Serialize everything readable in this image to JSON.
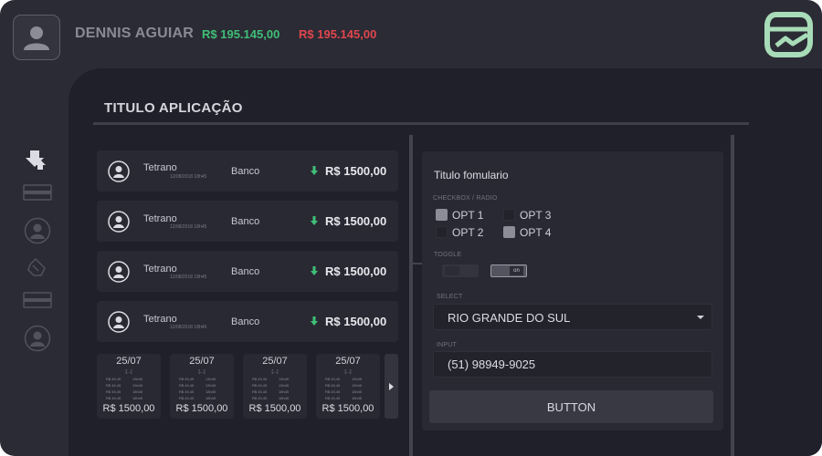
{
  "header": {
    "user_name": "DENNIS AGUIAR",
    "balance_green": "R$ 195.145,00",
    "balance_red": "R$ 195.145,00",
    "icons": [
      "avatar-icon",
      "wallet-logo-icon"
    ],
    "colors": {
      "positive": "#3fbf77",
      "negative": "#e0464e",
      "logo": "#a8dcb8"
    }
  },
  "page": {
    "title": "TITULO APLICAÇÃO"
  },
  "sidebar": {
    "icons": [
      "download-upload-icon",
      "card-icon",
      "user-icon",
      "hand-icon",
      "card-icon",
      "user-icon"
    ]
  },
  "list": {
    "items": [
      {
        "name": "Tetrano",
        "date": "12/08/2018 18h45",
        "bank": "Banco",
        "amount": "R$ 1500,00"
      },
      {
        "name": "Tetrano",
        "date": "12/08/2018 18h45",
        "bank": "Banco",
        "amount": "R$ 1500,00"
      },
      {
        "name": "Tetrano",
        "date": "12/08/2018 18h45",
        "bank": "Banco",
        "amount": "R$ 1500,00"
      },
      {
        "name": "Tetrano",
        "date": "12/08/2018 18h45",
        "bank": "Banco",
        "amount": "R$ 1500,00"
      }
    ]
  },
  "cards": {
    "items": [
      {
        "date": "25/07",
        "ellipsis": "[...]",
        "rows": [
          [
            "R$ 45,45",
            "13h45"
          ],
          [
            "R$ 45,45",
            "13h45"
          ],
          [
            "R$ 45,45",
            "18h45"
          ],
          [
            "R$ 45,45",
            "18h45"
          ]
        ],
        "total": "R$ 1500,00"
      },
      {
        "date": "25/07",
        "ellipsis": "[...]",
        "rows": [
          [
            "R$ 45,45",
            "13h45"
          ],
          [
            "R$ 45,45",
            "13h45"
          ],
          [
            "R$ 45,45",
            "18h45"
          ],
          [
            "R$ 45,45",
            "18h45"
          ]
        ],
        "total": "R$ 1500,00"
      },
      {
        "date": "25/07",
        "ellipsis": "[...]",
        "rows": [
          [
            "R$ 45,45",
            "13h45"
          ],
          [
            "R$ 45,45",
            "13h45"
          ],
          [
            "R$ 45,45",
            "18h45"
          ],
          [
            "R$ 45,45",
            "18h45"
          ]
        ],
        "total": "R$ 1500,00"
      },
      {
        "date": "25/07",
        "ellipsis": "[...]",
        "rows": [
          [
            "R$ 45,45",
            "13h45"
          ],
          [
            "R$ 45,45",
            "13h45"
          ],
          [
            "R$ 45,45",
            "18h45"
          ],
          [
            "R$ 45,45",
            "18h45"
          ]
        ],
        "total": "R$ 1500,00"
      }
    ],
    "next_icon": "chevron-right-icon"
  },
  "form": {
    "title": "Titulo fomulario",
    "checkbox_label": "CHECKBOX / RADIO",
    "options": [
      {
        "label": "OPT 1",
        "checked": true
      },
      {
        "label": "OPT 2",
        "checked": false
      },
      {
        "label": "OPT 3",
        "checked": false
      },
      {
        "label": "OPT 4",
        "checked": true
      }
    ],
    "toggle_label": "TOGGLE",
    "toggle_on_text": "on",
    "select_label": "SELECT",
    "select_value": "RIO GRANDE DO SUL",
    "input_label": "INPUT",
    "input_value": "(51) 98949-9025",
    "button_label": "BUTTON"
  }
}
